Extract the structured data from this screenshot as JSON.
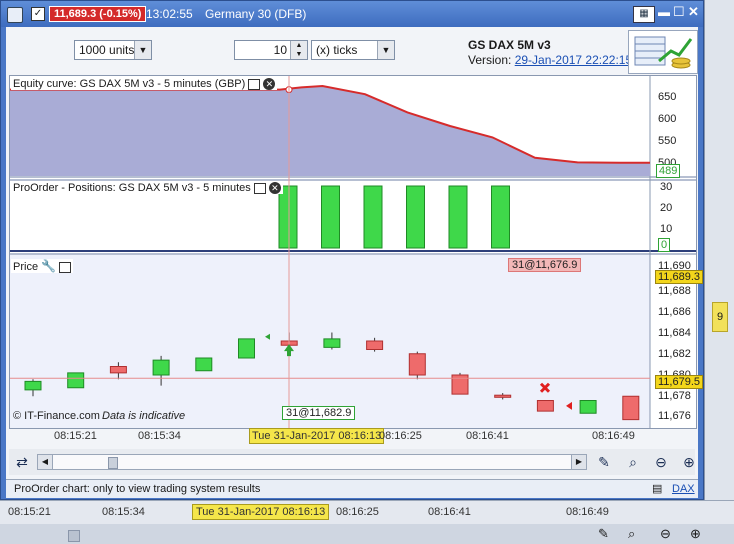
{
  "window": {
    "price_badge": "11,689.3 (-0.15%)",
    "time": "13:02:55",
    "instrument": "Germany 30 (DFB)"
  },
  "toolbar": {
    "units_select": "1000 units",
    "ticks_value": "10",
    "ticks_unit": "(x) ticks",
    "system_name": "GS DAX 5M v3",
    "version_label": "Version:",
    "version_link": "29-Jan-2017 22:22:15"
  },
  "panels": {
    "equity_title": "Equity curve: GS DAX 5M v3 - 5 minutes (GBP)",
    "equity_ticks": [
      "650",
      "600",
      "550",
      "500"
    ],
    "equity_last": "489",
    "positions_title": "ProOrder - Positions: GS DAX 5M v3 - 5 minutes",
    "positions_ticks": [
      "30",
      "20",
      "10"
    ],
    "positions_last": "0",
    "price_title": "Price",
    "price_ticks": [
      "11,690",
      "11,688",
      "11,686",
      "11,684",
      "11,682",
      "11,680",
      "11,678",
      "11,676"
    ],
    "last_price": "11,689.3",
    "current_price": "11,679.5",
    "order_label": "31@11,676.9",
    "cursor_label": "31@11,682.9",
    "copyright": "© IT-Finance.com",
    "indicative": "Data is indicative"
  },
  "xaxis": {
    "ticks": [
      "08:15:21",
      "08:15:34",
      "08:16:25",
      "08:16:41",
      "08:16:49"
    ],
    "cursor": "Tue 31-Jan-2017 08:16:13"
  },
  "status": {
    "text": "ProOrder chart: only to view trading system results",
    "link": "DAX"
  },
  "background": {
    "ticks": [
      "08:15:21",
      "08:15:34",
      "08:16:25",
      "08:16:41",
      "08:16:49"
    ],
    "cursor": "Tue 31-Jan-2017 08:16:13",
    "side_tag": "9"
  },
  "chart_data": {
    "type": "candlestick",
    "price_ylim": [
      11675,
      11691
    ],
    "candles": [
      {
        "o": 11678.4,
        "c": 11679.2,
        "h": 11679.4,
        "l": 11677.8,
        "dir": "up"
      },
      {
        "o": 11678.6,
        "c": 11680.0,
        "h": 11680.0,
        "l": 11678.6,
        "dir": "up"
      },
      {
        "o": 11680.0,
        "c": 11680.6,
        "h": 11681.0,
        "l": 11679.4,
        "dir": "down"
      },
      {
        "o": 11679.8,
        "c": 11681.2,
        "h": 11681.6,
        "l": 11678.8,
        "dir": "up"
      },
      {
        "o": 11680.2,
        "c": 11681.4,
        "h": 11681.4,
        "l": 11680.2,
        "dir": "up"
      },
      {
        "o": 11681.4,
        "c": 11683.2,
        "h": 11683.2,
        "l": 11681.4,
        "dir": "up"
      },
      {
        "o": 11683.0,
        "c": 11682.6,
        "h": 11683.8,
        "l": 11682.2,
        "dir": "down"
      },
      {
        "o": 11682.4,
        "c": 11683.2,
        "h": 11683.8,
        "l": 11682.2,
        "dir": "up"
      },
      {
        "o": 11683.0,
        "c": 11682.2,
        "h": 11683.3,
        "l": 11682.0,
        "dir": "down"
      },
      {
        "o": 11681.8,
        "c": 11679.8,
        "h": 11682.0,
        "l": 11679.4,
        "dir": "down"
      },
      {
        "o": 11679.8,
        "c": 11678.0,
        "h": 11680.0,
        "l": 11678.0,
        "dir": "down"
      },
      {
        "o": 11677.9,
        "c": 11677.7,
        "h": 11678.1,
        "l": 11677.5,
        "dir": "down"
      },
      {
        "o": 11677.4,
        "c": 11676.4,
        "h": 11677.4,
        "l": 11676.4,
        "dir": "down"
      },
      {
        "o": 11676.2,
        "c": 11677.4,
        "h": 11677.4,
        "l": 11676.2,
        "dir": "up"
      },
      {
        "o": 11677.8,
        "c": 11675.6,
        "h": 11677.8,
        "l": 11675.6,
        "dir": "down"
      }
    ],
    "equity": [
      650,
      655,
      658,
      640,
      600,
      570,
      545,
      500,
      490,
      489,
      489,
      489,
      489,
      489
    ],
    "equity_ylim": [
      460,
      680
    ],
    "positions": [
      31,
      31,
      31,
      31,
      31,
      31,
      0,
      0,
      0,
      0,
      0
    ],
    "positions_ylim": [
      0,
      33
    ]
  }
}
